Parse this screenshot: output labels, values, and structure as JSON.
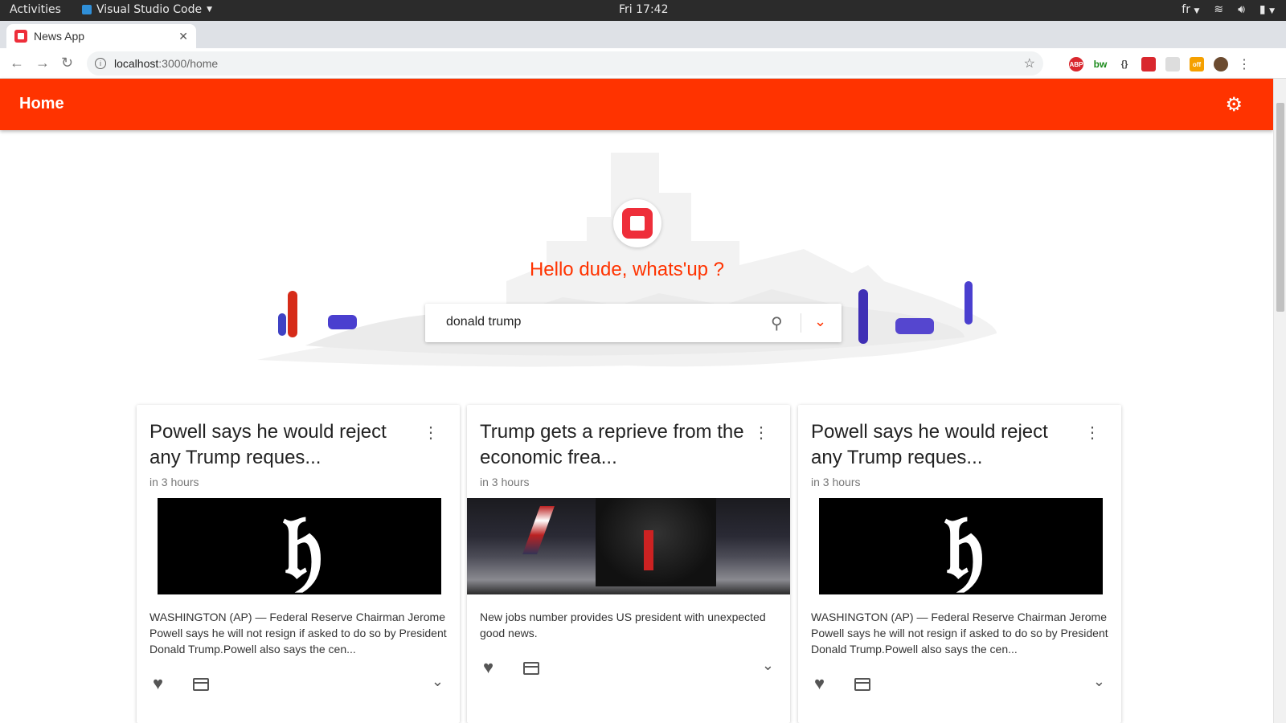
{
  "os": {
    "activities": "Activities",
    "app_name": "Visual Studio Code",
    "clock": "Fri 17:42",
    "lang": "fr"
  },
  "browser": {
    "tab_title": "News App",
    "url_host": "localhost",
    "url_path": ":3000/home",
    "extensions": [
      {
        "name": "ABP",
        "color": "#d9272e"
      },
      {
        "name": "bw",
        "color": "#1a8a1a"
      },
      {
        "name": "{ }",
        "color": "#444444"
      },
      {
        "name": "ext4",
        "color": "#d9272e"
      },
      {
        "name": "ext5",
        "color": "#cccccc"
      },
      {
        "name": "off",
        "color": "#f5a000"
      }
    ]
  },
  "header": {
    "title": "Home",
    "accent": "#ff3300"
  },
  "hero": {
    "greeting": "Hello dude, whats'up ?",
    "search_value": "donald trump"
  },
  "cards": [
    {
      "title": "Powell says he would reject any Trump reques...",
      "time": "in 3 hours",
      "description": "WASHINGTON (AP) — Federal Reserve Chairman Jerome Powell says he will not resign if asked to do so by President Donald Trump.Powell also says the cen...",
      "image_text": "𝔥"
    },
    {
      "title": "Trump gets a reprieve from the economic frea...",
      "time": "in 3 hours",
      "description": "New jobs number provides US president with unexpected good news."
    },
    {
      "title": "Powell says he would reject any Trump reques...",
      "time": "in 3 hours",
      "description": "WASHINGTON (AP) — Federal Reserve Chairman Jerome Powell says he will not resign if asked to do so by President Donald Trump.Powell also says the cen...",
      "image_text": "𝔥"
    }
  ]
}
